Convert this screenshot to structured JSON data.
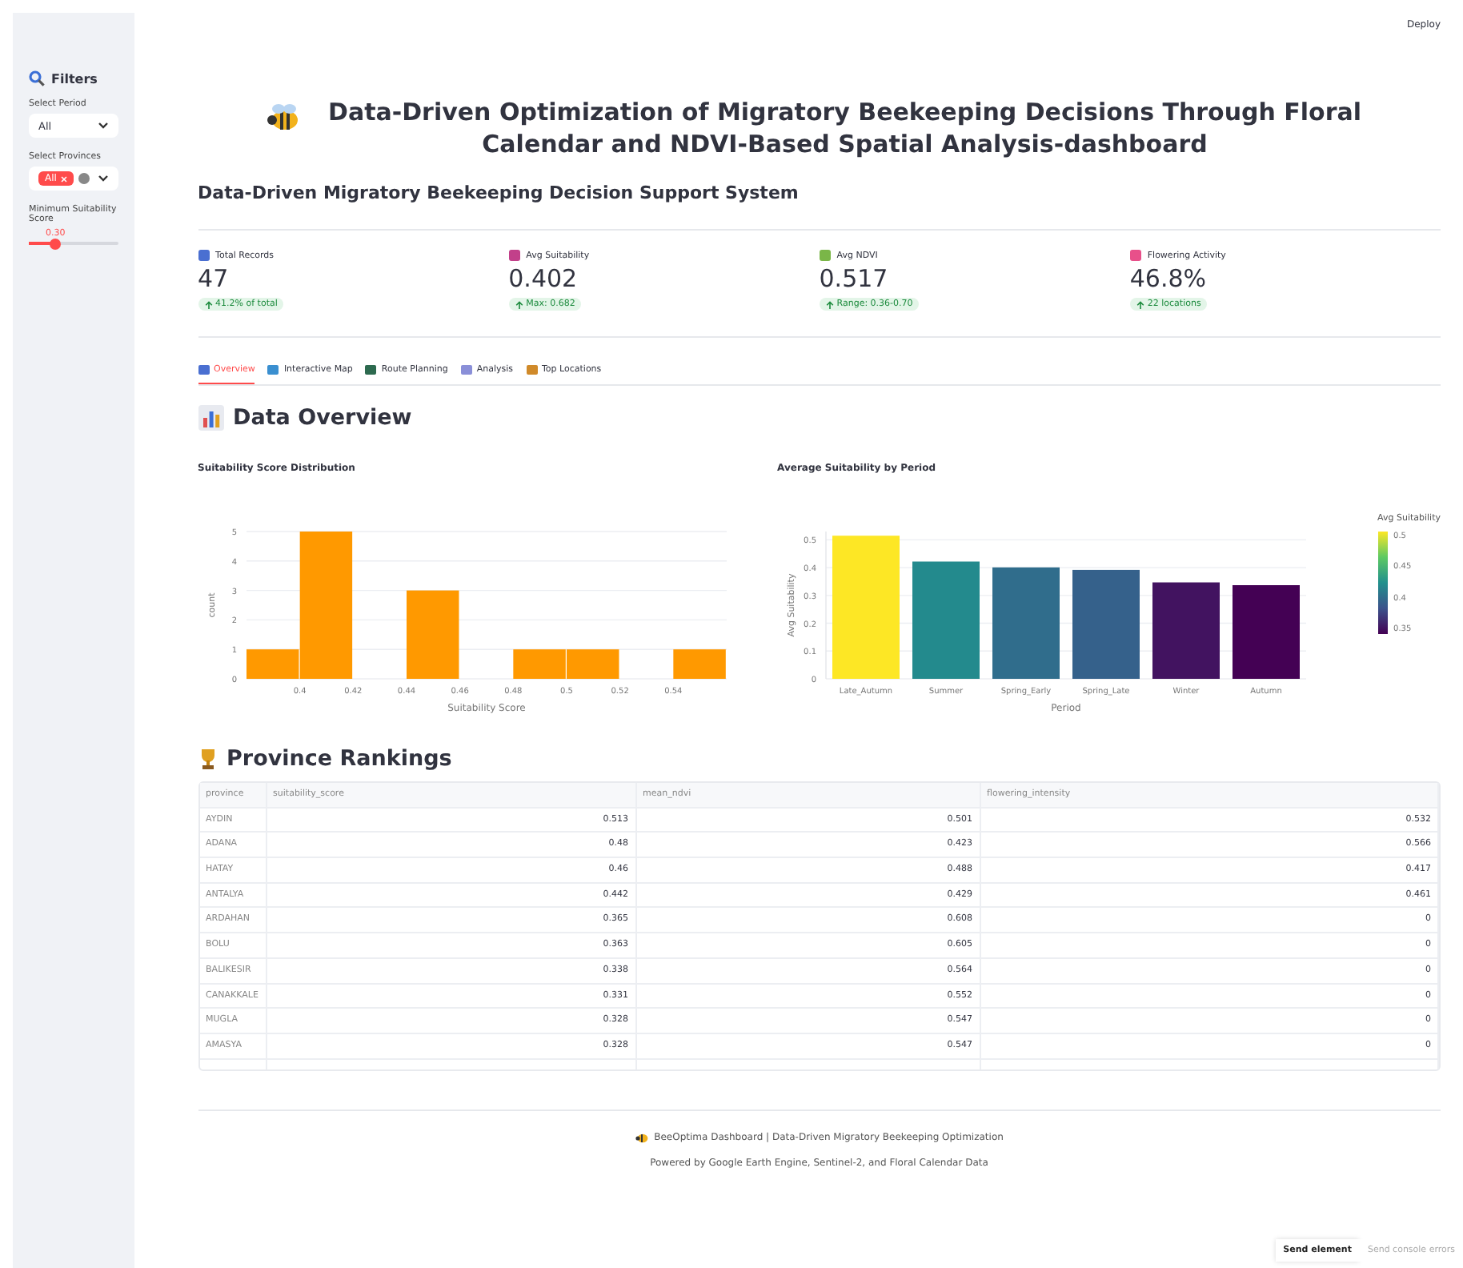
{
  "header": {
    "deploy": "Deploy"
  },
  "sidebar": {
    "title": "Filters",
    "period_label": "Select Period",
    "period_value": "All",
    "provinces_label": "Select Provinces",
    "province_tags": [
      "All"
    ],
    "slider_label": "Minimum Suitability Score",
    "slider_reading": "0.30",
    "slider": {
      "level": 0.3
    }
  },
  "title": "Data-Driven Optimization of Migratory Beekeeping Decisions Through Floral Calendar and NDVI-Based Spatial Analysis-dashboard",
  "subtitle": "Data-Driven Migratory Beekeeping Decision Support System",
  "metrics": [
    {
      "label": "Total Records",
      "value": "47",
      "delta": "41.2% of total",
      "color": "#4a6fd1"
    },
    {
      "label": "Avg Suitability",
      "value": "0.402",
      "delta": "Max: 0.682",
      "color": "#c2408a"
    },
    {
      "label": "Avg NDVI",
      "value": "0.517",
      "delta": "Range: 0.36-0.70",
      "color": "#7ab648"
    },
    {
      "label": "Flowering Activity",
      "value": "46.8%",
      "delta": "22 locations",
      "color": "#e8508a"
    }
  ],
  "tabs": [
    {
      "label": "Overview",
      "selected": true,
      "color": "#4a6fd1"
    },
    {
      "label": "Interactive Map",
      "selected": false,
      "color": "#3a8fd0"
    },
    {
      "label": "Route Planning",
      "selected": false,
      "color": "#2d6a4f"
    },
    {
      "label": "Analysis",
      "selected": false,
      "color": "#8a8fd8"
    },
    {
      "label": "Top Locations",
      "selected": false,
      "color": "#d08a2a"
    }
  ],
  "overview_heading": "Data Overview",
  "charts": [
    {
      "chart_data": {
        "type": "bar",
        "title": "Suitability Score Distribution",
        "xlabel": "Suitability Score",
        "ylabel": "count",
        "x": [
          0.39,
          0.41,
          0.45,
          0.49,
          0.51,
          0.55
        ],
        "values": [
          1,
          5,
          3,
          1,
          1,
          1
        ],
        "grid": true,
        "xlim": [
          0.38,
          0.56
        ],
        "ylim": [
          0,
          5
        ],
        "xticks": [
          {
            "value": 0.4,
            "label": "0.4"
          },
          {
            "value": 0.42,
            "label": "0.42"
          },
          {
            "value": 0.44,
            "label": "0.44"
          },
          {
            "value": 0.46,
            "label": "0.46"
          },
          {
            "value": 0.48,
            "label": "0.48"
          },
          {
            "value": 0.5,
            "label": "0.5"
          },
          {
            "value": 0.52,
            "label": "0.52"
          },
          {
            "value": 0.54,
            "label": "0.54"
          }
        ],
        "yticks": [
          0,
          1,
          2,
          3,
          4,
          5
        ]
      }
    },
    {
      "chart_data": {
        "type": "bar",
        "title": "Average Suitability by Period",
        "xlabel": "Period",
        "ylabel": "Avg Suitability",
        "categories": [
          "Late_Autumn",
          "Summer",
          "Spring_Early",
          "Spring_Late",
          "Winter",
          "Autumn"
        ],
        "values": [
          0.515,
          0.422,
          0.401,
          0.392,
          0.347,
          0.337
        ],
        "grid": true,
        "ylim": [
          0,
          0.53
        ],
        "yticks": [
          0,
          0.1,
          0.2,
          0.3,
          0.4,
          0.5
        ]
      },
      "colorbar": {
        "title": "Avg Suitability",
        "ticks": [
          "0.5",
          "0.45",
          "0.4",
          "0.35"
        ]
      }
    }
  ],
  "rankings": {
    "heading": "Province Rankings",
    "columns": [
      "province",
      "suitability_score",
      "mean_ndvi",
      "flowering_intensity"
    ],
    "rows": [
      [
        "AYDIN",
        "0.513",
        "0.501",
        "0.532"
      ],
      [
        "ADANA",
        "0.48",
        "0.423",
        "0.566"
      ],
      [
        "HATAY",
        "0.46",
        "0.488",
        "0.417"
      ],
      [
        "ANTALYA",
        "0.442",
        "0.429",
        "0.461"
      ],
      [
        "ARDAHAN",
        "0.365",
        "0.608",
        "0"
      ],
      [
        "BOLU",
        "0.363",
        "0.605",
        "0"
      ],
      [
        "BALIKESIR",
        "0.338",
        "0.564",
        "0"
      ],
      [
        "CANAKKALE",
        "0.331",
        "0.552",
        "0"
      ],
      [
        "MUGLA",
        "0.328",
        "0.547",
        "0"
      ],
      [
        "AMASYA",
        "0.328",
        "0.547",
        "0"
      ]
    ]
  },
  "footer": {
    "line1": "BeeOptima Dashboard | Data-Driven Migratory Beekeeping Optimization",
    "line2": "Powered by Google Earth Engine, Sentinel-2, and Floral Calendar Data"
  },
  "toolbar": {
    "send_element": "Send element",
    "send_errors": "Send console errors"
  }
}
